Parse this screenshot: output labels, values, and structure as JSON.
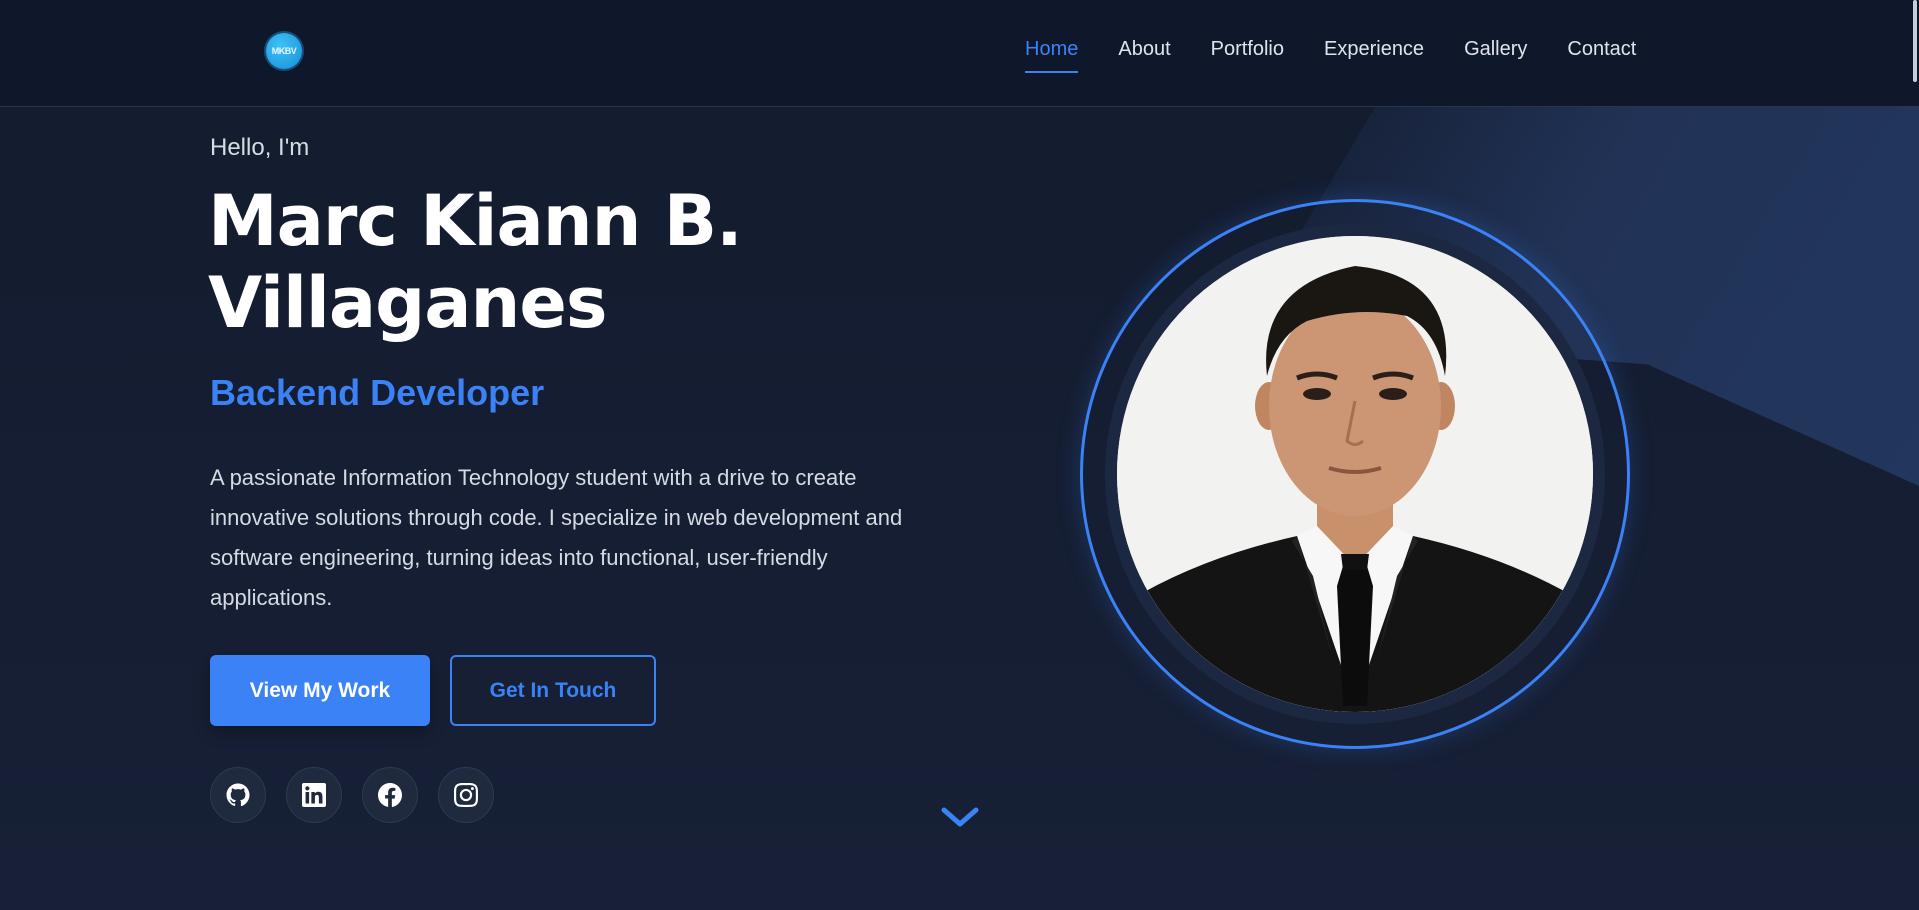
{
  "header": {
    "logo_text": "MKBV",
    "nav": [
      {
        "label": "Home",
        "active": true
      },
      {
        "label": "About",
        "active": false
      },
      {
        "label": "Portfolio",
        "active": false
      },
      {
        "label": "Experience",
        "active": false
      },
      {
        "label": "Gallery",
        "active": false
      },
      {
        "label": "Contact",
        "active": false
      }
    ]
  },
  "hero": {
    "greeting": "Hello, I'm",
    "name_line1": "Marc Kiann B.",
    "name_line2": "Villaganes",
    "role": "Backend Developer",
    "bio": "A passionate Information Technology student with a drive to create innovative solutions through code. I specialize in web development and software engineering, turning ideas into functional, user-friendly applications.",
    "primary_button": "View My Work",
    "secondary_button": "Get In Touch"
  },
  "socials": [
    {
      "icon": "github-icon"
    },
    {
      "icon": "linkedin-icon"
    },
    {
      "icon": "facebook-icon"
    },
    {
      "icon": "instagram-icon"
    }
  ],
  "colors": {
    "accent": "#3b82f6",
    "background": "#141c2f",
    "navbar": "#0f182b"
  }
}
